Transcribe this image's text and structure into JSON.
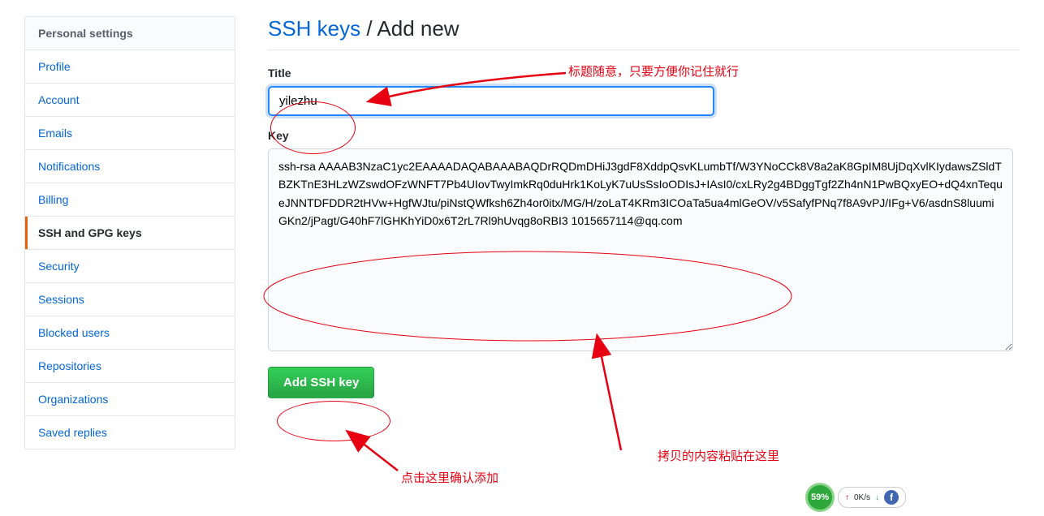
{
  "sidebar": {
    "header": "Personal settings",
    "items": [
      {
        "label": "Profile",
        "active": false,
        "name": "sidebar-item-profile"
      },
      {
        "label": "Account",
        "active": false,
        "name": "sidebar-item-account"
      },
      {
        "label": "Emails",
        "active": false,
        "name": "sidebar-item-emails"
      },
      {
        "label": "Notifications",
        "active": false,
        "name": "sidebar-item-notifications"
      },
      {
        "label": "Billing",
        "active": false,
        "name": "sidebar-item-billing"
      },
      {
        "label": "SSH and GPG keys",
        "active": true,
        "name": "sidebar-item-ssh-gpg-keys"
      },
      {
        "label": "Security",
        "active": false,
        "name": "sidebar-item-security"
      },
      {
        "label": "Sessions",
        "active": false,
        "name": "sidebar-item-sessions"
      },
      {
        "label": "Blocked users",
        "active": false,
        "name": "sidebar-item-blocked-users"
      },
      {
        "label": "Repositories",
        "active": false,
        "name": "sidebar-item-repositories"
      },
      {
        "label": "Organizations",
        "active": false,
        "name": "sidebar-item-organizations"
      },
      {
        "label": "Saved replies",
        "active": false,
        "name": "sidebar-item-saved-replies"
      }
    ]
  },
  "header": {
    "link": "SSH keys",
    "separator": " / ",
    "sub": "Add new"
  },
  "form": {
    "title_label": "Title",
    "title_value": "yilezhu",
    "key_label": "Key",
    "key_value": "ssh-rsa AAAAB3NzaC1yc2EAAAADAQABAAABAQDrRQDmDHiJ3gdF8XddpQsvKLumbTf/W3YNoCCk8V8a2aK8GpIM8UjDqXvlKIydawsZSldTBZKTnE3HLzWZswdOFzWNFT7Pb4UIovTwyImkRq0duHrk1KoLyK7uUsSsIoODIsJ+IAsI0/cxLRy2g4BDggTgf2Zh4nN1PwBQxyEO+dQ4xnTequeJNNTDFDDR2tHVw+HgfWJtu/piNstQWfksh6Zh4or0itx/MG/H/zoLaT4KRm3ICOaTa5ua4mlGeOV/v5SafyfPNq7f8A9vPJ/IFg+V6/asdnS8luumiGKn2/jPagt/G40hF7lGHKhYiD0x6T2rL7Rl9hUvqg8oRBI3 1015657114@qq.com",
    "submit_label": "Add SSH key"
  },
  "annotations": {
    "title_hint": "标题随意，只要方便你记住就行",
    "key_hint": "拷贝的内容粘贴在这里",
    "button_hint": "点击这里确认添加"
  },
  "status": {
    "percent": "59%",
    "upload": "0K/s"
  }
}
